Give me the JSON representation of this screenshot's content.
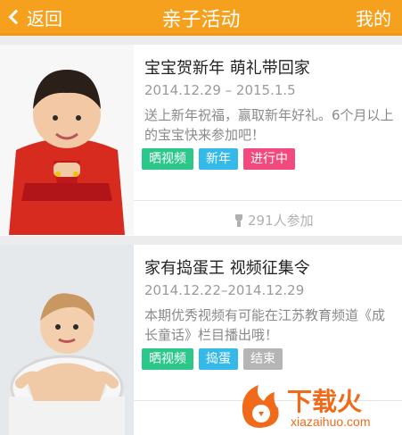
{
  "header": {
    "back_label": "返回",
    "title": "亲子活动",
    "mine_label": "我的",
    "accent": "#f5a11e"
  },
  "cards": [
    {
      "title": "宝宝贺新年 萌礼带回家",
      "date": "2014.12.29 – 2015.1.5",
      "desc": "送上新年祝福，赢取新年好礼。6个月以上的宝宝快来参加吧！",
      "tags": [
        "晒视频",
        "新年",
        "进行中"
      ],
      "participants": "291人参加"
    },
    {
      "title": "家有捣蛋王 视频征集令",
      "date": "2014.12.22–2014.12.29",
      "desc": "本期优秀视频有可能在江苏教育频道《成长童话》栏目播出哦！",
      "tags": [
        "晒视频",
        "捣蛋",
        "结束"
      ]
    }
  ],
  "watermark": {
    "brand": "下载火",
    "domain": "xiazaihuo.com"
  }
}
